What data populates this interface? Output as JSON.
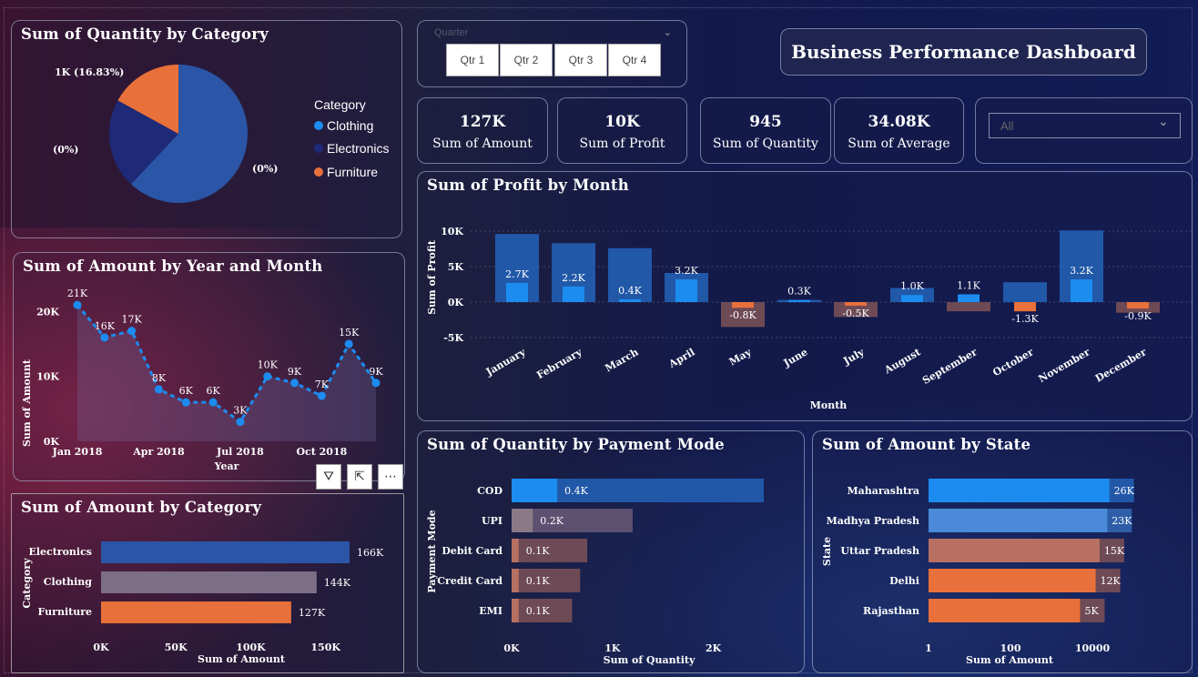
{
  "title": "Business Performance Dashboard",
  "slicer": {
    "label": "Quarter",
    "buttons": [
      "Qtr 1",
      "Qtr 2",
      "Qtr 3",
      "Qtr 4"
    ]
  },
  "dropdown": {
    "value": "All"
  },
  "kpis": [
    {
      "value": "127K",
      "label": "Sum of Amount"
    },
    {
      "value": "10K",
      "label": "Sum of Profit"
    },
    {
      "value": "945",
      "label": "Sum of Quantity"
    },
    {
      "value": "34.08K",
      "label": "Sum of Average"
    }
  ],
  "pie": {
    "title": "Sum of Quantity by Category",
    "legend_title": "Category",
    "labels": [
      "1K (16.83%)",
      "(0%)",
      "(0%)"
    ]
  },
  "colors": {
    "clothing": "#2b55a6",
    "electronics": "#1e2a77",
    "furniture": "#e8703a",
    "bright_blue": "#1c8cf0",
    "gray": "#7c6e86",
    "salmon": "#b87063"
  },
  "chart_data": [
    {
      "type": "pie",
      "title": "Sum of Quantity by Category",
      "categories": [
        "Clothing",
        "Electronics",
        "Furniture"
      ],
      "values": [
        62,
        21,
        17
      ],
      "legend": "right"
    },
    {
      "type": "line",
      "title": "Sum of Amount by Year and Month",
      "xlabel": "Year",
      "ylabel": "Sum of Amount",
      "x": [
        "Jan 2018",
        "Feb 2018",
        "Mar 2018",
        "Apr 2018",
        "May 2018",
        "Jun 2018",
        "Jul 2018",
        "Aug 2018",
        "Sep 2018",
        "Oct 2018",
        "Nov 2018",
        "Dec 2018"
      ],
      "values": [
        21,
        16,
        17,
        8,
        6,
        6,
        3,
        10,
        9,
        7,
        15,
        9
      ],
      "labels": [
        "21K",
        "16K",
        "17K",
        "8K",
        "6K",
        "6K",
        "3K",
        "10K",
        "9K",
        "7K",
        "15K",
        "9K"
      ],
      "xticks": [
        "Jan 2018",
        "Apr 2018",
        "Jul 2018",
        "Oct 2018"
      ],
      "yticks": [
        "0K",
        "10K",
        "20K"
      ],
      "ylim": [
        0,
        22
      ]
    },
    {
      "type": "bar",
      "title": "Sum of Profit by Month",
      "xlabel": "Month",
      "ylabel": "Sum of Profit",
      "categories": [
        "January",
        "February",
        "March",
        "April",
        "May",
        "June",
        "July",
        "August",
        "September",
        "October",
        "November",
        "December"
      ],
      "values": [
        2.7,
        2.2,
        0.4,
        3.2,
        -0.8,
        0.3,
        -0.5,
        1.0,
        1.1,
        -1.3,
        3.2,
        -0.9
      ],
      "labels": [
        "2.7K",
        "2.2K",
        "0.4K",
        "3.2K",
        "-0.8K",
        "0.3K",
        "-0.5K",
        "1.0K",
        "1.1K",
        "-1.3K",
        "3.2K",
        "-0.9K"
      ],
      "totals": [
        9.6,
        8.3,
        7.6,
        4.1,
        -3.5,
        0.3,
        -2.1,
        2.0,
        -1.3,
        2.8,
        10.1,
        -1.5
      ],
      "yticks": [
        "10K",
        "5K",
        "0K",
        "-5K"
      ],
      "ylim": [
        -5,
        10
      ]
    },
    {
      "type": "bar",
      "title": "Sum of Amount by Category",
      "xlabel": "Sum of Amount",
      "ylabel": "Category",
      "categories": [
        "Electronics",
        "Clothing",
        "Furniture"
      ],
      "values": [
        166,
        144,
        127
      ],
      "labels": [
        "166K",
        "144K",
        "127K"
      ],
      "xticks": [
        "0K",
        "50K",
        "100K",
        "150K"
      ]
    },
    {
      "type": "bar",
      "title": "Sum of Quantity by Payment Mode",
      "xlabel": "Sum of Quantity",
      "ylabel": "Payment Mode",
      "categories": [
        "COD",
        "UPI",
        "Debit Card",
        "Credit Card",
        "EMI"
      ],
      "values": [
        0.4,
        0.2,
        0.1,
        0.1,
        0.1
      ],
      "totals": [
        2.5,
        1.2,
        0.75,
        0.68,
        0.6
      ],
      "labels": [
        "0.4K",
        "0.2K",
        "0.1K",
        "0.1K",
        "0.1K"
      ],
      "xticks": [
        "0K",
        "1K",
        "2K"
      ]
    },
    {
      "type": "bar",
      "title": "Sum of Amount by State",
      "xlabel": "Sum of Amount",
      "ylabel": "State",
      "categories": [
        "Maharashtra",
        "Madhya Pradesh",
        "Uttar Pradesh",
        "Delhi",
        "Rajasthan"
      ],
      "values": [
        26,
        23,
        15,
        12,
        5
      ],
      "labels": [
        "26K",
        "23K",
        "15K",
        "12K",
        "5K"
      ],
      "xticks": [
        "1",
        "100",
        "10000"
      ],
      "scale": "log"
    }
  ]
}
